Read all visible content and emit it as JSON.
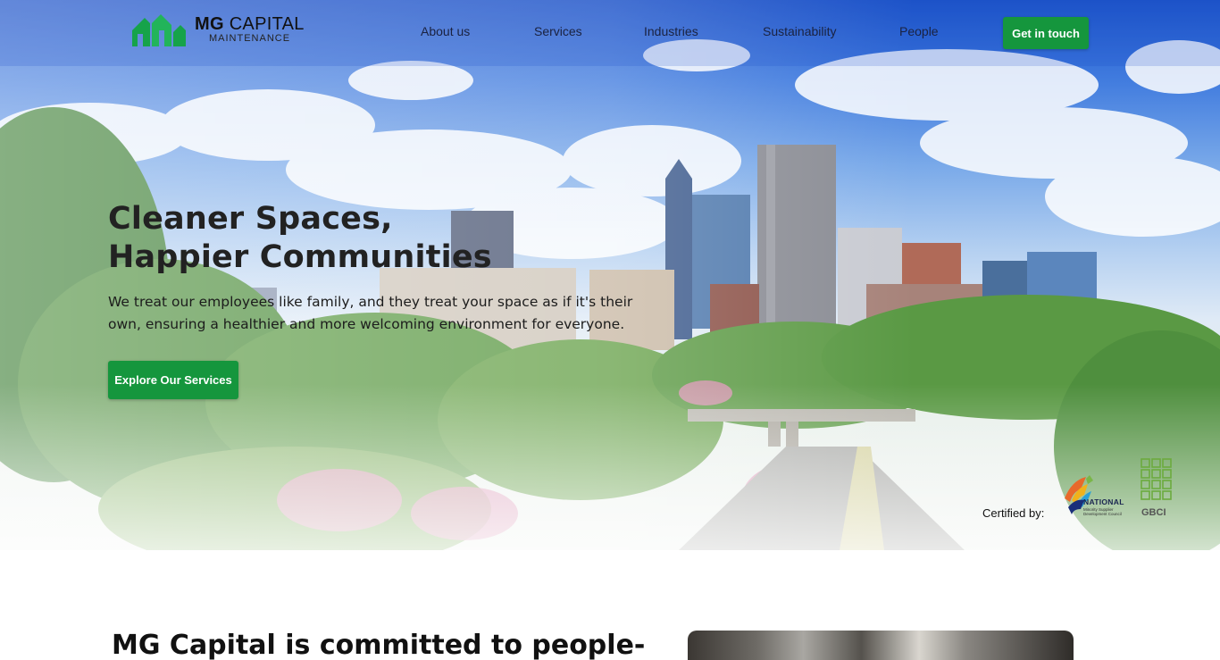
{
  "brand": {
    "name_bold": "MG",
    "name_rest": "CAPITAL",
    "tagline": "MAINTENANCE",
    "primary_color": "#15963d"
  },
  "nav": {
    "links": [
      {
        "label": "About us"
      },
      {
        "label": "Services"
      },
      {
        "label": "Industries"
      },
      {
        "label": "Sustainability"
      },
      {
        "label": "People"
      }
    ],
    "cta_label": "Get in touch"
  },
  "hero": {
    "title_line1": "Cleaner Spaces,",
    "title_line2": "Happier Communities",
    "subtitle": "We treat our employees like family, and they treat your space as if it's their own, ensuring a healthier and more welcoming environment for everyone.",
    "button_label": "Explore Our Services",
    "background": "city-skyline-photo"
  },
  "certifications": {
    "label": "Certified by:",
    "nmsdc": {
      "title": "NATIONAL",
      "subtitle": "Minority Supplier Development Council"
    },
    "gbci": {
      "title": "GBCI"
    }
  },
  "section": {
    "title": "MG Capital is committed to people-"
  }
}
